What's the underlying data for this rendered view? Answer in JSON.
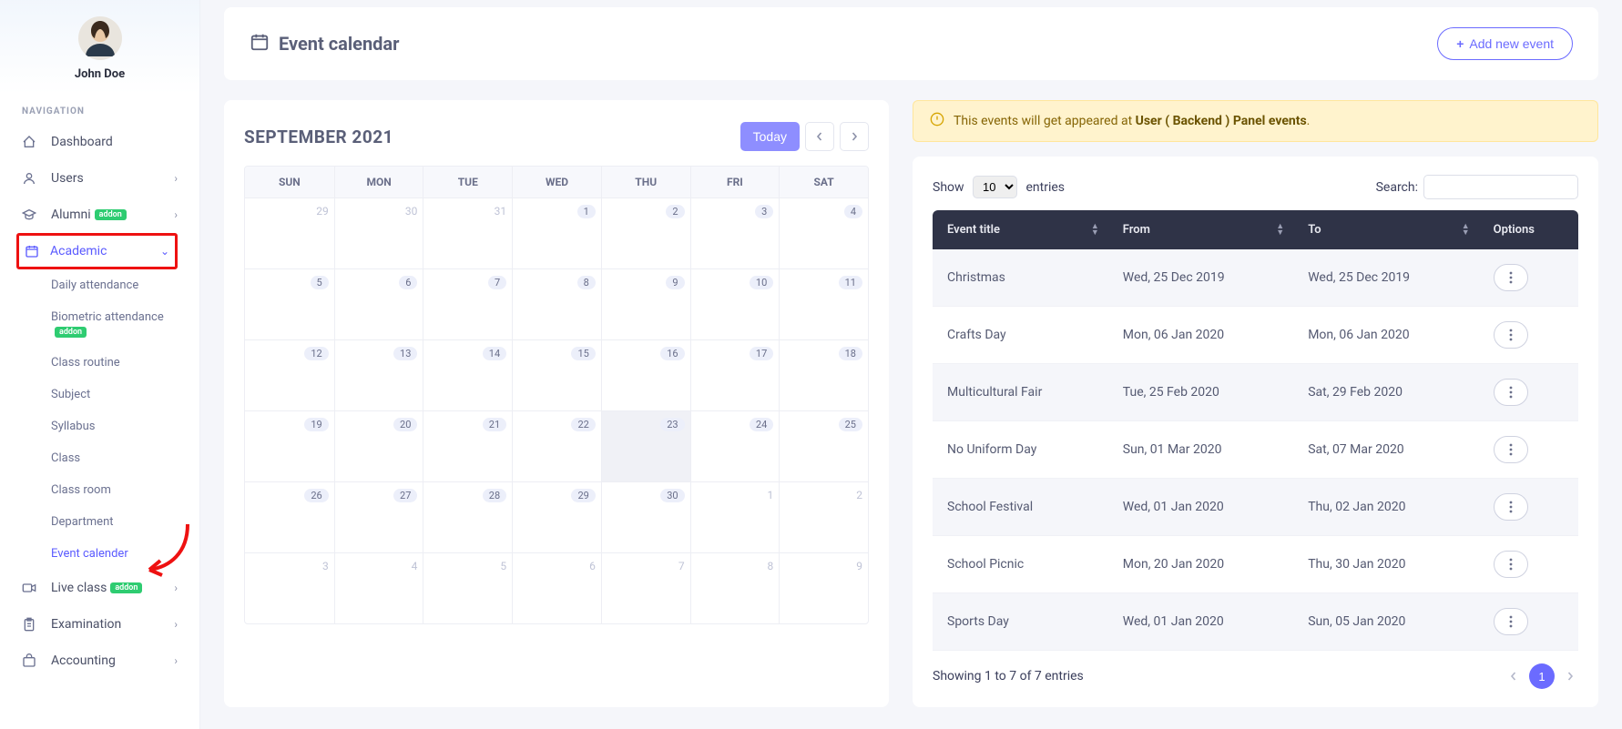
{
  "profile": {
    "name": "John Doe"
  },
  "nav": {
    "header": "NAVIGATION",
    "items": [
      {
        "icon": "dashboard",
        "label": "Dashboard",
        "expand": false,
        "addon": false
      },
      {
        "icon": "users",
        "label": "Users",
        "expand": true,
        "addon": false
      },
      {
        "icon": "cap",
        "label": "Alumni",
        "expand": true,
        "addon": true
      },
      {
        "icon": "calendar",
        "label": "Academic",
        "expand": true,
        "addon": false,
        "highlight": true,
        "open": true
      },
      {
        "icon": "video",
        "label": "Live class",
        "expand": true,
        "addon": true
      },
      {
        "icon": "clipboard",
        "label": "Examination",
        "expand": true,
        "addon": false
      },
      {
        "icon": "bag",
        "label": "Accounting",
        "expand": true,
        "addon": false
      }
    ],
    "addon_label": "addon",
    "academic_sub": [
      "Daily attendance",
      "Biometric attendance",
      "Class routine",
      "Subject",
      "Syllabus",
      "Class",
      "Class room",
      "Department",
      "Event calender"
    ],
    "biometric_addon": true,
    "active_sub": "Event calender"
  },
  "page": {
    "title": "Event calendar",
    "add_label": "Add new event"
  },
  "calendar": {
    "month_label": "SEPTEMBER 2021",
    "today_label": "Today",
    "dow": [
      "SUN",
      "MON",
      "TUE",
      "WED",
      "THU",
      "FRI",
      "SAT"
    ],
    "weeks": [
      [
        {
          "n": "29",
          "muted": true
        },
        {
          "n": "30",
          "muted": true
        },
        {
          "n": "31",
          "muted": true
        },
        {
          "n": "1",
          "pill": true
        },
        {
          "n": "2",
          "pill": true
        },
        {
          "n": "3",
          "pill": true
        },
        {
          "n": "4",
          "pill": true
        }
      ],
      [
        {
          "n": "5",
          "pill": true
        },
        {
          "n": "6",
          "pill": true
        },
        {
          "n": "7",
          "pill": true
        },
        {
          "n": "8",
          "pill": true
        },
        {
          "n": "9",
          "pill": true
        },
        {
          "n": "10",
          "pill": true
        },
        {
          "n": "11",
          "pill": true
        }
      ],
      [
        {
          "n": "12",
          "pill": true
        },
        {
          "n": "13",
          "pill": true
        },
        {
          "n": "14",
          "pill": true
        },
        {
          "n": "15",
          "pill": true
        },
        {
          "n": "16",
          "pill": true
        },
        {
          "n": "17",
          "pill": true
        },
        {
          "n": "18",
          "pill": true
        }
      ],
      [
        {
          "n": "19",
          "pill": true
        },
        {
          "n": "20",
          "pill": true
        },
        {
          "n": "21",
          "pill": true
        },
        {
          "n": "22",
          "pill": true
        },
        {
          "n": "23",
          "pill": true,
          "today": true
        },
        {
          "n": "24",
          "pill": true
        },
        {
          "n": "25",
          "pill": true
        }
      ],
      [
        {
          "n": "26",
          "pill": true
        },
        {
          "n": "27",
          "pill": true
        },
        {
          "n": "28",
          "pill": true
        },
        {
          "n": "29",
          "pill": true
        },
        {
          "n": "30",
          "pill": true
        },
        {
          "n": "1",
          "muted": true
        },
        {
          "n": "2",
          "muted": true
        }
      ],
      [
        {
          "n": "3",
          "muted": true
        },
        {
          "n": "4",
          "muted": true
        },
        {
          "n": "5",
          "muted": true
        },
        {
          "n": "6",
          "muted": true
        },
        {
          "n": "7",
          "muted": true
        },
        {
          "n": "8",
          "muted": true
        },
        {
          "n": "9",
          "muted": true
        }
      ]
    ]
  },
  "notice": {
    "prefix": "This events will get appeared at ",
    "strong": "User ( Backend ) Panel events",
    "suffix": "."
  },
  "datatable": {
    "show_prefix": "Show",
    "show_value": "10",
    "show_suffix": "entries",
    "search_label": "Search:",
    "columns": [
      "Event title",
      "From",
      "To",
      "Options"
    ],
    "rows": [
      {
        "title": "Christmas",
        "from": "Wed, 25 Dec 2019",
        "to": "Wed, 25 Dec 2019"
      },
      {
        "title": "Crafts Day",
        "from": "Mon, 06 Jan 2020",
        "to": "Mon, 06 Jan 2020"
      },
      {
        "title": "Multicultural Fair",
        "from": "Tue, 25 Feb 2020",
        "to": "Sat, 29 Feb 2020"
      },
      {
        "title": "No Uniform Day",
        "from": "Sun, 01 Mar 2020",
        "to": "Sat, 07 Mar 2020"
      },
      {
        "title": "School Festival",
        "from": "Wed, 01 Jan 2020",
        "to": "Thu, 02 Jan 2020"
      },
      {
        "title": "School Picnic",
        "from": "Mon, 20 Jan 2020",
        "to": "Thu, 30 Jan 2020"
      },
      {
        "title": "Sports Day",
        "from": "Wed, 01 Jan 2020",
        "to": "Sun, 05 Jan 2020"
      }
    ],
    "info": "Showing 1 to 7 of 7 entries",
    "page_current": "1"
  }
}
